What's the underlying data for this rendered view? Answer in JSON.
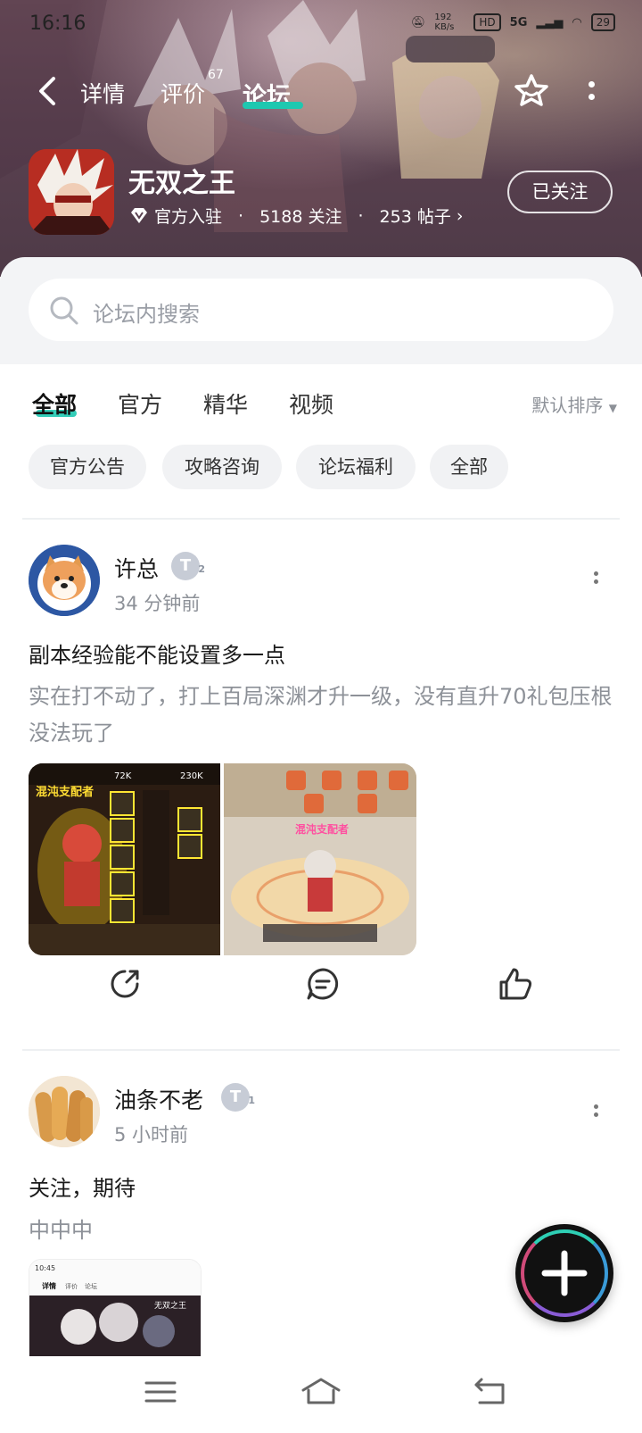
{
  "status": {
    "time": "16:16",
    "speed": "192 KB/s",
    "hd": "HD",
    "network": "5G",
    "battery": "29"
  },
  "nav": {
    "tabs": [
      {
        "label": "详情"
      },
      {
        "label": "评价",
        "badge": "67"
      },
      {
        "label": "论坛"
      }
    ]
  },
  "game": {
    "title": "无双之王",
    "official": "官方入驻",
    "followers": "5188 关注",
    "posts": "253 帖子",
    "follow_button": "已关注"
  },
  "search": {
    "placeholder": "论坛内搜索"
  },
  "filters": {
    "tabs": [
      "全部",
      "官方",
      "精华",
      "视频"
    ],
    "sort": "默认排序",
    "chips": [
      "官方公告",
      "攻略咨询",
      "论坛福利",
      "全部"
    ]
  },
  "posts": [
    {
      "author": "许总",
      "level": "T",
      "level_num": "2",
      "time": "34 分钟前",
      "title": "副本经验能不能设置多一点",
      "body": "实在打不动了，打上百局深渊才升一级，没有直升70礼包压根没法玩了",
      "img1_texts": [
        "混沌支配者",
        "72K",
        "230K"
      ],
      "img2_texts": [
        "混沌支配者"
      ]
    },
    {
      "author": "油条不老",
      "level": "T",
      "level_num": "1",
      "time": "5 小时前",
      "title": "关注，期待",
      "body": "中中中",
      "thumb_texts": {
        "time": "10:45",
        "tab1": "详情",
        "tab2": "评价",
        "tab3": "论坛",
        "game": "无双之王"
      }
    }
  ],
  "colors": {
    "accent": "#1ec8b0",
    "muted": "#8d9198"
  }
}
